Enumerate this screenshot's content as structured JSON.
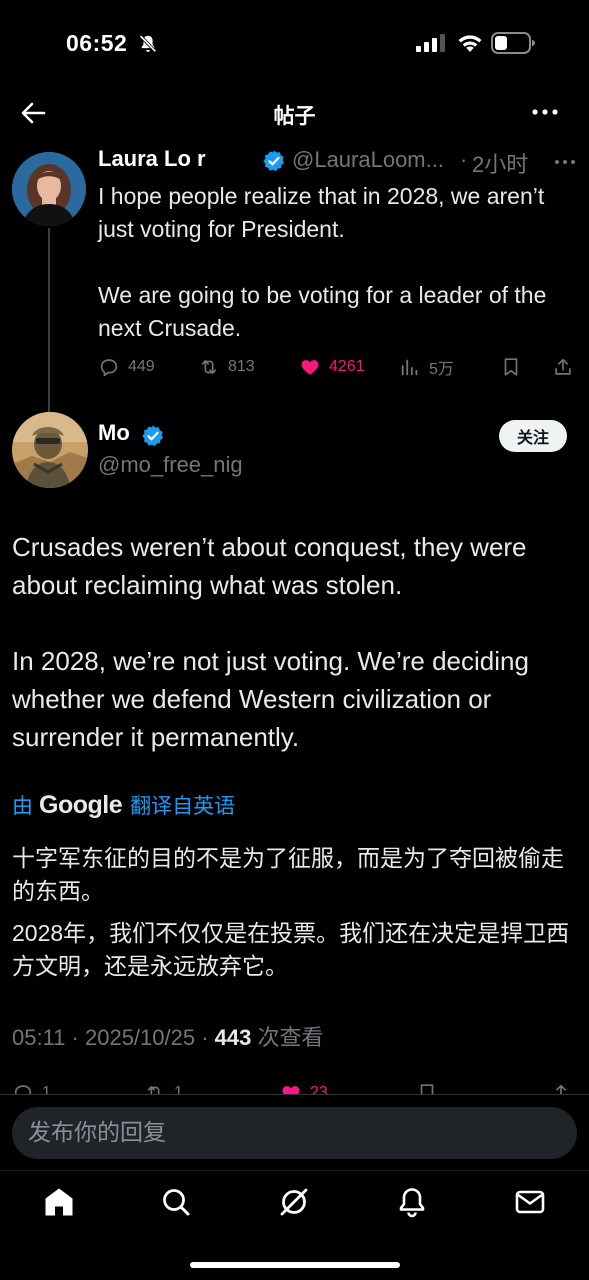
{
  "status_bar": {
    "time": "06:52"
  },
  "header": {
    "title": "帖子"
  },
  "parent_tweet": {
    "name": "Laura Lo  r",
    "handle": "@LauraLoom...",
    "dot": "·",
    "time": "2小时",
    "text": "I hope people realize that in 2028, we aren’t just voting for President.\n\nWe are going to be voting for a leader of the next Crusade.",
    "stats": {
      "replies": "449",
      "retweets": "813",
      "likes": "4261",
      "views": "5万"
    }
  },
  "main_tweet": {
    "name": "Mo",
    "handle": "@mo_free_nig",
    "follow_label": "关注",
    "text": "Crusades weren’t about conquest, they were about reclaiming what was stolen.\n\nIn 2028, we’re not just voting. We’re deciding whether we defend Western civilization or surrender it permanently.",
    "translation": {
      "prefix": "由",
      "provider": "Google",
      "suffix": "翻译自英语",
      "paragraph1": "十字军东征的目的不是为了征服，而是为了夺回被偷走的东西。",
      "paragraph2": "2028年，我们不仅仅是在投票。我们还在决定是捍卫西方文明，还是永远放弃它。"
    },
    "meta": {
      "time": "05:11",
      "sep1": " · ",
      "date": "2025/10/25",
      "sep2": " · ",
      "views": "443",
      "views_label": " 次查看"
    },
    "stats": {
      "replies": "1",
      "retweets": "1",
      "likes": "23"
    }
  },
  "reply": {
    "placeholder": "发布你的回复"
  },
  "colors": {
    "accent": "#1d9bf0",
    "like": "#f91880",
    "muted": "#71767b",
    "background": "#000000"
  },
  "icons": [
    "back-arrow-icon",
    "more-icon",
    "verified-icon",
    "reply-icon",
    "retweet-icon",
    "heart-icon",
    "views-icon",
    "bookmark-icon",
    "share-icon",
    "home-icon",
    "search-icon",
    "grok-icon",
    "bell-icon",
    "mail-icon"
  ]
}
